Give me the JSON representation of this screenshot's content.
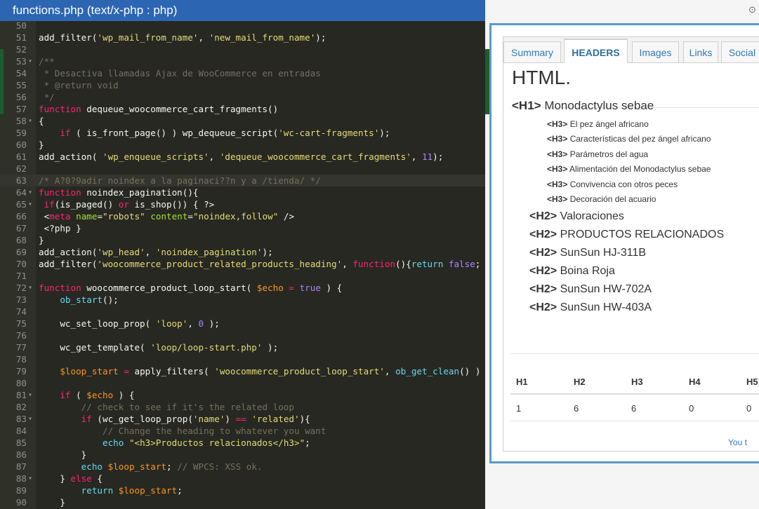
{
  "editor": {
    "title": "functions.php (text/x-php : php)",
    "lines": [
      {
        "n": "50",
        "fold": "",
        "parts": []
      },
      {
        "n": "51",
        "fold": "",
        "parts": [
          [
            "plain",
            "add_filter("
          ],
          [
            "string",
            "'wp_mail_from_name'"
          ],
          [
            "plain",
            ", "
          ],
          [
            "string",
            "'new_mail_from_name'"
          ],
          [
            "plain",
            ");"
          ]
        ]
      },
      {
        "n": "52",
        "fold": "",
        "parts": []
      },
      {
        "n": "53",
        "fold": "▾",
        "parts": [
          [
            "comment",
            "/**"
          ]
        ]
      },
      {
        "n": "54",
        "fold": "",
        "parts": [
          [
            "comment",
            " * Desactiva llamadas Ajax de WooCommerce en entradas"
          ]
        ]
      },
      {
        "n": "55",
        "fold": "",
        "parts": [
          [
            "comment",
            " * @return void"
          ]
        ]
      },
      {
        "n": "56",
        "fold": "",
        "parts": [
          [
            "comment",
            " */"
          ]
        ]
      },
      {
        "n": "57",
        "fold": "",
        "parts": [
          [
            "keyword",
            "function"
          ],
          [
            "plain",
            " dequeue_woocommerce_cart_fragments()"
          ]
        ]
      },
      {
        "n": "58",
        "fold": "▾",
        "parts": [
          [
            "plain",
            "{"
          ]
        ]
      },
      {
        "n": "59",
        "fold": "",
        "parts": [
          [
            "plain",
            "    "
          ],
          [
            "keyword",
            "if"
          ],
          [
            "plain",
            " ( is_front_page() ) wp_dequeue_script("
          ],
          [
            "string",
            "'wc-cart-fragments'"
          ],
          [
            "plain",
            ");"
          ]
        ]
      },
      {
        "n": "60",
        "fold": "",
        "parts": [
          [
            "plain",
            "}"
          ]
        ]
      },
      {
        "n": "61",
        "fold": "",
        "parts": [
          [
            "plain",
            "add_action( "
          ],
          [
            "string",
            "'wp_enqueue_scripts'"
          ],
          [
            "plain",
            ", "
          ],
          [
            "string",
            "'dequeue_woocommerce_cart_fragments'"
          ],
          [
            "plain",
            ", "
          ],
          [
            "number",
            "11"
          ],
          [
            "plain",
            ");"
          ]
        ]
      },
      {
        "n": "62",
        "fold": "",
        "parts": []
      },
      {
        "n": "63",
        "fold": "",
        "active": true,
        "parts": [
          [
            "comment",
            "/* A?0?9adir noindex a la paginaci??n y a /tienda/ */"
          ]
        ]
      },
      {
        "n": "64",
        "fold": "▾",
        "parts": [
          [
            "keyword",
            "function"
          ],
          [
            "plain",
            " noindex_pagination(){"
          ]
        ]
      },
      {
        "n": "65",
        "fold": "▾",
        "parts": [
          [
            "plain",
            " "
          ],
          [
            "keyword",
            "if"
          ],
          [
            "plain",
            "(is_paged() "
          ],
          [
            "keyword",
            "or"
          ],
          [
            "plain",
            " is_shop()) { ?>"
          ]
        ]
      },
      {
        "n": "66",
        "fold": "",
        "parts": [
          [
            "plain",
            " <"
          ],
          [
            "tag",
            "meta"
          ],
          [
            "plain",
            " "
          ],
          [
            "attr",
            "name"
          ],
          [
            "plain",
            "="
          ],
          [
            "string",
            "\"robots\""
          ],
          [
            "plain",
            " "
          ],
          [
            "attr",
            "content"
          ],
          [
            "plain",
            "="
          ],
          [
            "string",
            "\"noindex,follow\""
          ],
          [
            "plain",
            " />"
          ]
        ]
      },
      {
        "n": "67",
        "fold": "",
        "parts": [
          [
            "plain",
            " <?php }"
          ]
        ]
      },
      {
        "n": "68",
        "fold": "",
        "parts": [
          [
            "plain",
            "}"
          ]
        ]
      },
      {
        "n": "69",
        "fold": "",
        "parts": [
          [
            "plain",
            "add_action("
          ],
          [
            "string",
            "'wp_head'"
          ],
          [
            "plain",
            ", "
          ],
          [
            "string",
            "'noindex_pagination'"
          ],
          [
            "plain",
            ");"
          ]
        ]
      },
      {
        "n": "70",
        "fold": "",
        "parts": [
          [
            "plain",
            "add_filter("
          ],
          [
            "string",
            "'woocommerce_product_related_products_heading'"
          ],
          [
            "plain",
            ", "
          ],
          [
            "keyword",
            "function"
          ],
          [
            "plain",
            "(){"
          ],
          [
            "builtin",
            "return"
          ],
          [
            "plain",
            " "
          ],
          [
            "number",
            "false"
          ],
          [
            "plain",
            ";"
          ]
        ]
      },
      {
        "n": "71",
        "fold": "",
        "parts": []
      },
      {
        "n": "72",
        "fold": "▾",
        "parts": [
          [
            "keyword",
            "function"
          ],
          [
            "plain",
            " woocommerce_product_loop_start( "
          ],
          [
            "var",
            "$echo"
          ],
          [
            "plain",
            " "
          ],
          [
            "keyword",
            "="
          ],
          [
            "plain",
            " "
          ],
          [
            "number",
            "true"
          ],
          [
            "plain",
            " ) {"
          ]
        ]
      },
      {
        "n": "73",
        "fold": "",
        "parts": [
          [
            "plain",
            "    "
          ],
          [
            "builtin",
            "ob_start"
          ],
          [
            "plain",
            "();"
          ]
        ]
      },
      {
        "n": "74",
        "fold": "",
        "parts": []
      },
      {
        "n": "75",
        "fold": "",
        "parts": [
          [
            "plain",
            "    wc_set_loop_prop( "
          ],
          [
            "string",
            "'loop'"
          ],
          [
            "plain",
            ", "
          ],
          [
            "number",
            "0"
          ],
          [
            "plain",
            " );"
          ]
        ]
      },
      {
        "n": "76",
        "fold": "",
        "parts": []
      },
      {
        "n": "77",
        "fold": "",
        "parts": [
          [
            "plain",
            "    wc_get_template( "
          ],
          [
            "string",
            "'loop/loop-start.php'"
          ],
          [
            "plain",
            " );"
          ]
        ]
      },
      {
        "n": "78",
        "fold": "",
        "parts": []
      },
      {
        "n": "79",
        "fold": "",
        "parts": [
          [
            "plain",
            "    "
          ],
          [
            "var",
            "$loop_start"
          ],
          [
            "plain",
            " "
          ],
          [
            "keyword",
            "="
          ],
          [
            "plain",
            " apply_filters( "
          ],
          [
            "string",
            "'woocommerce_product_loop_start'"
          ],
          [
            "plain",
            ", "
          ],
          [
            "builtin",
            "ob_get_clean"
          ],
          [
            "plain",
            "() )"
          ]
        ]
      },
      {
        "n": "80",
        "fold": "",
        "parts": []
      },
      {
        "n": "81",
        "fold": "▾",
        "parts": [
          [
            "plain",
            "    "
          ],
          [
            "keyword",
            "if"
          ],
          [
            "plain",
            " ( "
          ],
          [
            "var",
            "$echo"
          ],
          [
            "plain",
            " ) {"
          ]
        ]
      },
      {
        "n": "82",
        "fold": "",
        "parts": [
          [
            "comment",
            "        // check to see if it's the related loop"
          ]
        ]
      },
      {
        "n": "83",
        "fold": "▾",
        "parts": [
          [
            "plain",
            "        "
          ],
          [
            "keyword",
            "if"
          ],
          [
            "plain",
            " (wc_get_loop_prop("
          ],
          [
            "string",
            "'name'"
          ],
          [
            "plain",
            ") "
          ],
          [
            "keyword",
            "=="
          ],
          [
            "plain",
            " "
          ],
          [
            "string",
            "'related'"
          ],
          [
            "plain",
            "){"
          ]
        ]
      },
      {
        "n": "84",
        "fold": "",
        "parts": [
          [
            "comment",
            "            // Change the heading to whatever you want"
          ]
        ]
      },
      {
        "n": "85",
        "fold": "",
        "parts": [
          [
            "plain",
            "            "
          ],
          [
            "builtin",
            "echo"
          ],
          [
            "plain",
            " "
          ],
          [
            "string",
            "\"<h3>Productos relacionados</h3>\""
          ],
          [
            "plain",
            ";"
          ]
        ]
      },
      {
        "n": "86",
        "fold": "",
        "parts": [
          [
            "plain",
            "        }"
          ]
        ]
      },
      {
        "n": "87",
        "fold": "",
        "parts": [
          [
            "plain",
            "        "
          ],
          [
            "builtin",
            "echo"
          ],
          [
            "plain",
            " "
          ],
          [
            "var",
            "$loop_start"
          ],
          [
            "plain",
            "; "
          ],
          [
            "comment",
            "// WPCS: XSS ok."
          ]
        ]
      },
      {
        "n": "88",
        "fold": "▾",
        "parts": [
          [
            "plain",
            "    } "
          ],
          [
            "keyword",
            "else"
          ],
          [
            "plain",
            " {"
          ]
        ]
      },
      {
        "n": "89",
        "fold": "",
        "parts": [
          [
            "plain",
            "        "
          ],
          [
            "builtin",
            "return"
          ],
          [
            "plain",
            " "
          ],
          [
            "var",
            "$loop_start"
          ],
          [
            "plain",
            ";"
          ]
        ]
      },
      {
        "n": "90",
        "fold": "",
        "parts": [
          [
            "plain",
            "    }"
          ]
        ]
      }
    ]
  },
  "panel": {
    "tabs": [
      {
        "label": "Summary",
        "active": false
      },
      {
        "label": "HEADERS",
        "active": true
      },
      {
        "label": "Images",
        "active": false
      },
      {
        "label": "Links",
        "active": false
      },
      {
        "label": "Social",
        "active": false
      }
    ],
    "heading_type": "HTML.",
    "headings": [
      {
        "level": "H1",
        "tag": "<H1>",
        "text": "Monodactylus sebae"
      },
      {
        "level": "H3",
        "tag": "<H3>",
        "text": "El pez ángel africano"
      },
      {
        "level": "H3",
        "tag": "<H3>",
        "text": "Características del pez ángel africano"
      },
      {
        "level": "H3",
        "tag": "<H3>",
        "text": "Parámetros del agua"
      },
      {
        "level": "H3",
        "tag": "<H3>",
        "text": "Alimentación del Monodactylus sebae"
      },
      {
        "level": "H3",
        "tag": "<H3>",
        "text": "Convivencia con otros peces"
      },
      {
        "level": "H3",
        "tag": "<H3>",
        "text": "Decoración del acuario"
      },
      {
        "level": "H2",
        "tag": "<H2>",
        "text": "Valoraciones"
      },
      {
        "level": "H2",
        "tag": "<H2>",
        "text": "PRODUCTOS RELACIONADOS"
      },
      {
        "level": "H2",
        "tag": "<H2>",
        "text": "SunSun HJ-311B"
      },
      {
        "level": "H2",
        "tag": "<H2>",
        "text": "Boina Roja"
      },
      {
        "level": "H2",
        "tag": "<H2>",
        "text": "SunSun HW-702A"
      },
      {
        "level": "H2",
        "tag": "<H2>",
        "text": "SunSun HW-403A"
      }
    ],
    "counts": {
      "headers": [
        "H1",
        "H2",
        "H3",
        "H4",
        "H5"
      ],
      "values": [
        "1",
        "6",
        "6",
        "0",
        "0"
      ]
    },
    "footer_link": "You t"
  },
  "background": {
    "corner_icon": "⊙"
  }
}
